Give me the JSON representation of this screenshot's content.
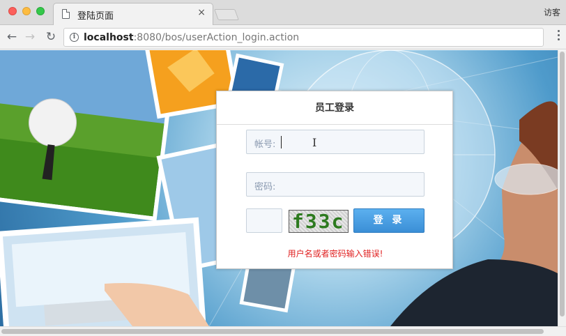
{
  "browser": {
    "tab_title": "登陆页面",
    "tab_close": "×",
    "profile_name": "访客",
    "url_host": "localhost",
    "url_rest": ":8080/bos/userAction_login.action",
    "icons": [
      "back-arrow-icon",
      "forward-arrow-icon",
      "reload-icon",
      "info-icon",
      "menu-dots-icon"
    ]
  },
  "login": {
    "title": "员工登录",
    "username_label": "帐号:",
    "password_label": "密码:",
    "captcha_text": "f33c",
    "login_button": "登 录",
    "error_message": "用户名或者密码输入错误!"
  },
  "colors": {
    "button": "#3b8fd6",
    "error": "#e02020",
    "captcha_text": "#2d7a1f"
  }
}
